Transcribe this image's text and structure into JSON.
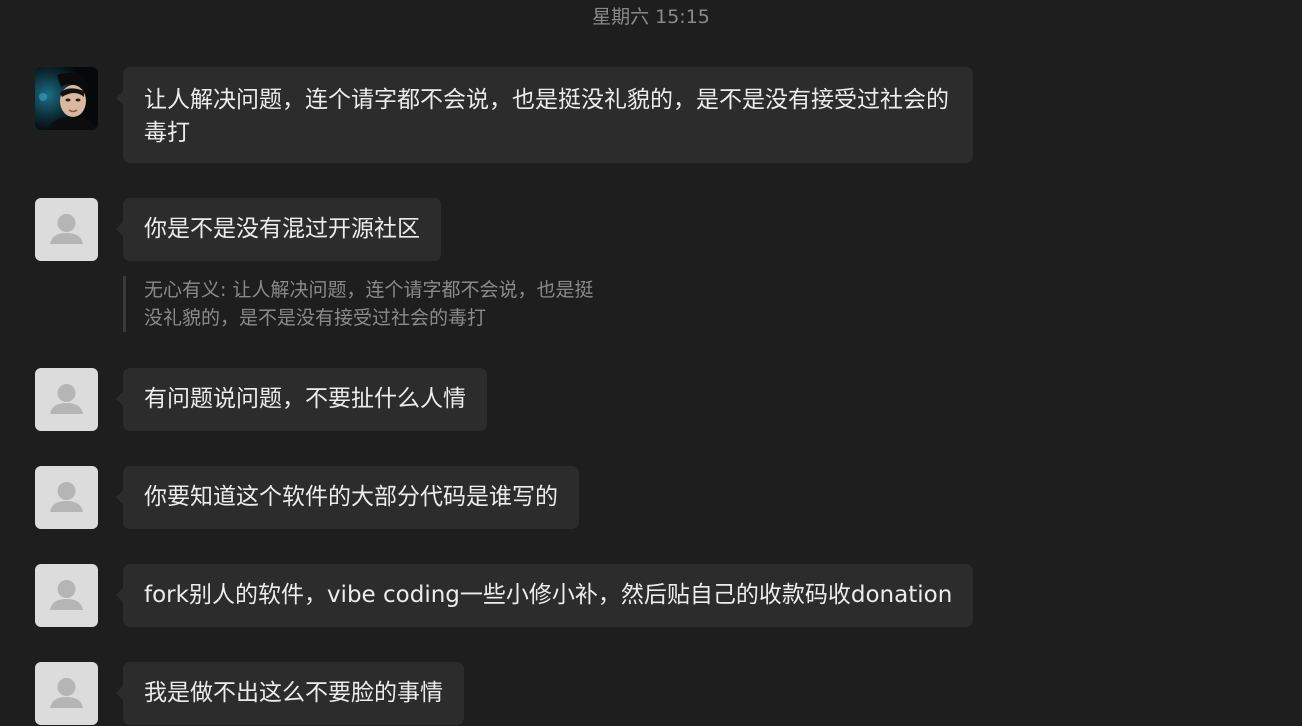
{
  "chat": {
    "timestamp": "星期六 15:15",
    "messages": [
      {
        "avatar": "photo-avatar",
        "text": "让人解决问题，连个请字都不会说，也是挺没礼貌的，是不是没有接受过社会的毒打"
      },
      {
        "avatar": "default-avatar",
        "text": "你是不是没有混过开源社区",
        "quote": {
          "line1": "无心有义: 让人解决问题，连个请字都不会说，也是挺",
          "line2": "没礼貌的，是不是没有接受过社会的毒打"
        }
      },
      {
        "avatar": "default-avatar",
        "text": "有问题说问题，不要扯什么人情"
      },
      {
        "avatar": "default-avatar",
        "text": "你要知道这个软件的大部分代码是谁写的"
      },
      {
        "avatar": "default-avatar",
        "text": "fork别人的软件，vibe coding一些小修小补，然后贴自己的收款码收donation"
      },
      {
        "avatar": "default-avatar",
        "text": "我是做不出这么不要脸的事情"
      }
    ]
  }
}
